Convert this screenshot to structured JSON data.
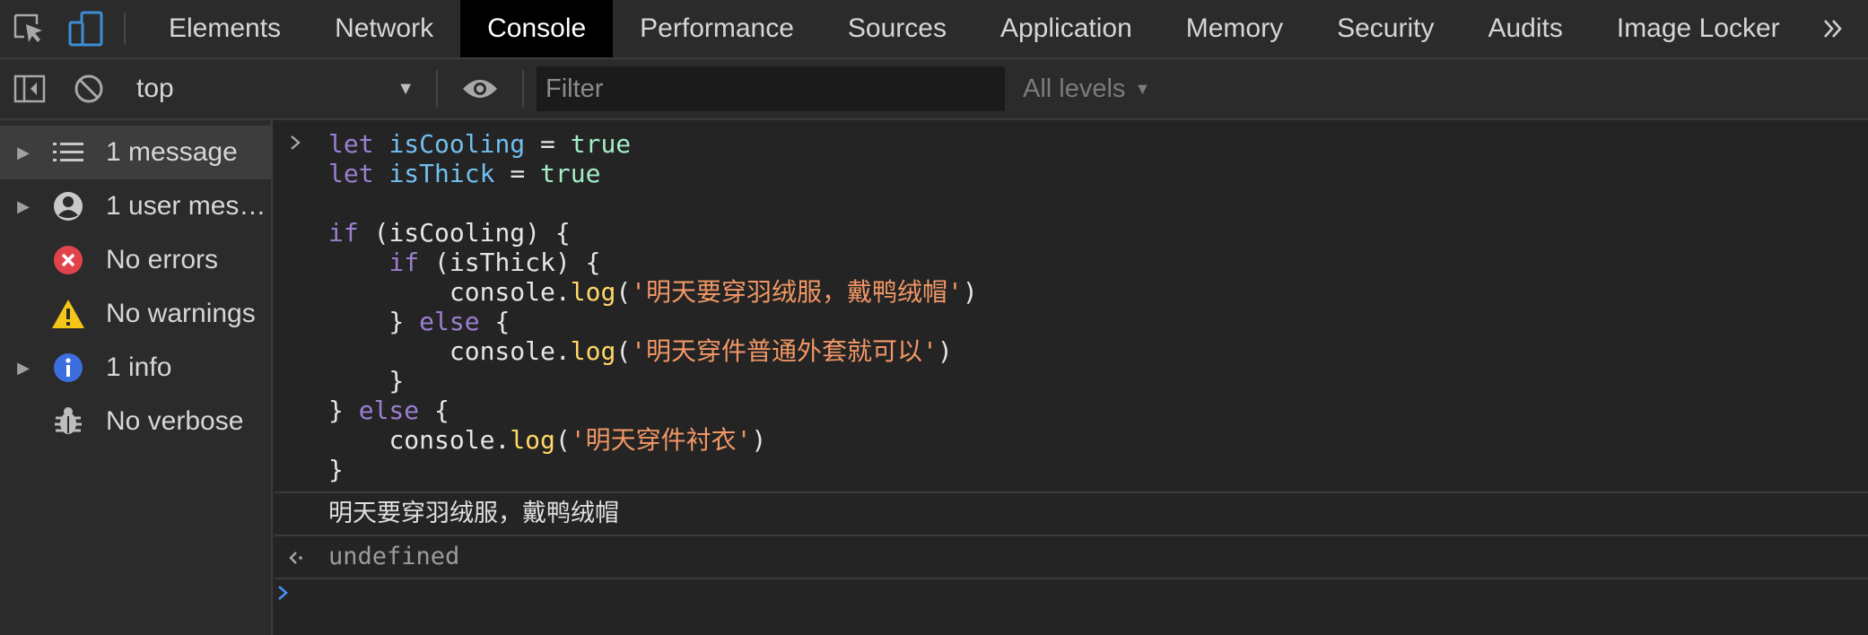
{
  "tabs": [
    {
      "label": "Elements",
      "active": false
    },
    {
      "label": "Network",
      "active": false
    },
    {
      "label": "Console",
      "active": true
    },
    {
      "label": "Performance",
      "active": false
    },
    {
      "label": "Sources",
      "active": false
    },
    {
      "label": "Application",
      "active": false
    },
    {
      "label": "Memory",
      "active": false
    },
    {
      "label": "Security",
      "active": false
    },
    {
      "label": "Audits",
      "active": false
    },
    {
      "label": "Image Locker",
      "active": false
    }
  ],
  "toolbar": {
    "context": "top",
    "filter_placeholder": "Filter",
    "levels": "All levels"
  },
  "sidebar": {
    "items": [
      {
        "label": "1 message",
        "icon": "list-icon",
        "expandable": true,
        "selected": true
      },
      {
        "label": "1 user mes…",
        "icon": "user-icon",
        "expandable": true,
        "selected": false
      },
      {
        "label": "No errors",
        "icon": "error-icon",
        "expandable": false,
        "selected": false
      },
      {
        "label": "No warnings",
        "icon": "warning-icon",
        "expandable": false,
        "selected": false
      },
      {
        "label": "1 info",
        "icon": "info-icon",
        "expandable": true,
        "selected": false
      },
      {
        "label": "No verbose",
        "icon": "bug-icon",
        "expandable": false,
        "selected": false
      }
    ]
  },
  "console": {
    "code": {
      "kw_let": "let",
      "kw_if": "if",
      "kw_else": "else",
      "var_cooling": "isCooling",
      "var_thick": "isThick",
      "bool_true": "true",
      "obj_console": "console",
      "fn_log": "log",
      "str_1": "'明天要穿羽绒服，戴鸭绒帽'",
      "str_2": "'明天穿件普通外套就可以'",
      "str_3": "'明天穿件衬衣'"
    },
    "log_output": "明天要穿羽绒服，戴鸭绒帽",
    "result": "undefined"
  },
  "colors": {
    "keyword": "#9a7fd0",
    "variable": "#71bff0",
    "boolean": "#a3eec6",
    "string": "#f29766",
    "method": "#ffd866",
    "prompt_active": "#4a8cf7"
  }
}
